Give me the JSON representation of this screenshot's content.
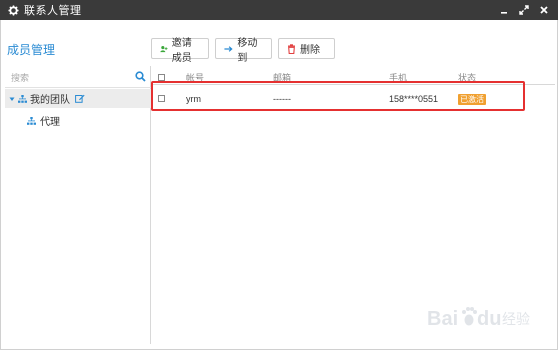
{
  "window": {
    "title": "联系人管理",
    "controls": {
      "minimize": "–",
      "maximize": "⤢",
      "close": "✕"
    }
  },
  "section_title": "成员管理",
  "toolbar": {
    "invite_label": "邀请成员",
    "move_label": "移动到",
    "delete_label": "删除"
  },
  "search": {
    "placeholder": "搜索"
  },
  "tree": {
    "root_label": "我的团队",
    "child_label": "代理"
  },
  "table": {
    "columns": [
      "帐号",
      "邮箱",
      "手机",
      "状态"
    ],
    "rows": [
      {
        "account": "yrm",
        "email": "------",
        "phone": "158****0551",
        "status": "已激活"
      }
    ]
  },
  "colors": {
    "titlebar": "#3a3a3a",
    "accent": "#2a8bd3",
    "badge": "#f0a030",
    "highlight": "#e53030",
    "invite_icon": "#3aa63a",
    "move_icon": "#2a8bd3",
    "delete_icon": "#e24040"
  },
  "watermark": {
    "text": "Baidu 经验"
  }
}
